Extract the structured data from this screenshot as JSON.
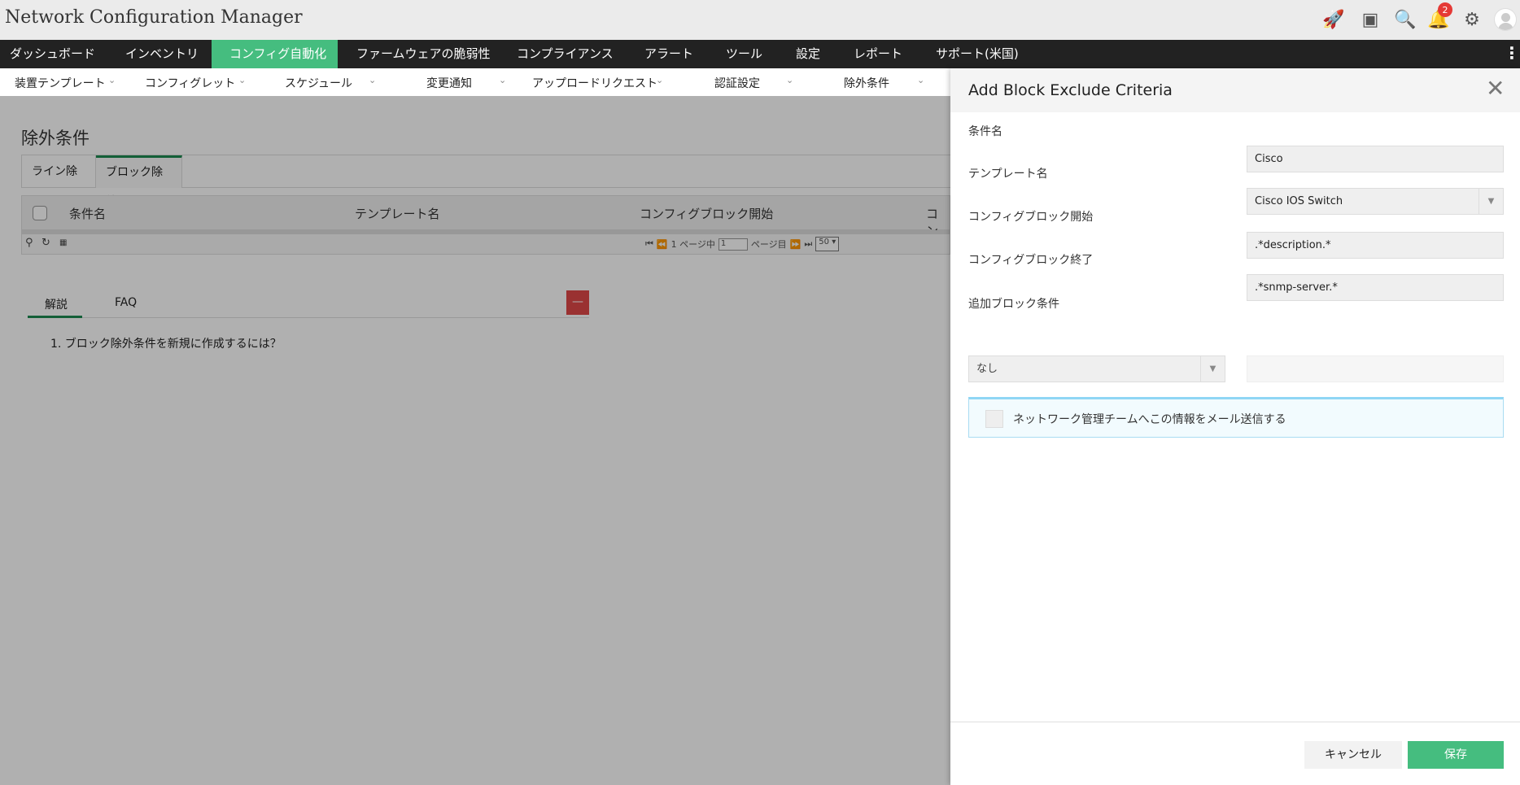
{
  "app": {
    "title": "Network Configuration Manager",
    "notification_count": "2"
  },
  "nav": {
    "items": [
      "ダッシュボード",
      "インベントリ",
      "コンフィグ自動化",
      "ファームウェアの脆弱性",
      "コンプライアンス",
      "アラート",
      "ツール",
      "設定",
      "レポート",
      "サポート(米国)"
    ],
    "active": "コンフィグ自動化"
  },
  "subnav": {
    "items": [
      "装置テンプレート",
      "コンフィグレット",
      "スケジュール",
      "変更通知",
      "アップロードリクエスト",
      "認証設定",
      "除外条件"
    ]
  },
  "page": {
    "title": "除外条件",
    "tabs": [
      "ライン除外",
      "ブロック除外"
    ],
    "active_tab": "ブロック除外",
    "table": {
      "columns": [
        "条件名",
        "テンプレート名",
        "コンフィグブロック開始",
        "コン"
      ]
    },
    "pager": {
      "prefix": "1 ページ中",
      "page": "1",
      "suffix": "ページ目",
      "per_page": "50"
    },
    "help": {
      "tabs": [
        "解説",
        "FAQ"
      ],
      "collapse": "—",
      "items": [
        "1. ブロック除外条件を新規に作成するには？"
      ]
    }
  },
  "panel": {
    "title": "Add Block Exclude Criteria",
    "fields": [
      {
        "label": "条件名",
        "value": "Cisco"
      },
      {
        "label": "テンプレート名",
        "value": "Cisco IOS Switch"
      },
      {
        "label": "コンフィグブロック開始",
        "value": ".*description.*"
      },
      {
        "label": "コンフィグブロック終了",
        "value": ".*snmp-server.*"
      }
    ],
    "extra_label": "追加ブロック条件",
    "extra_select": "なし",
    "extra_value": "",
    "mail_label": "ネットワーク管理チームへこの情報をメール送信する",
    "cancel": "キャンセル",
    "save": "保存"
  }
}
